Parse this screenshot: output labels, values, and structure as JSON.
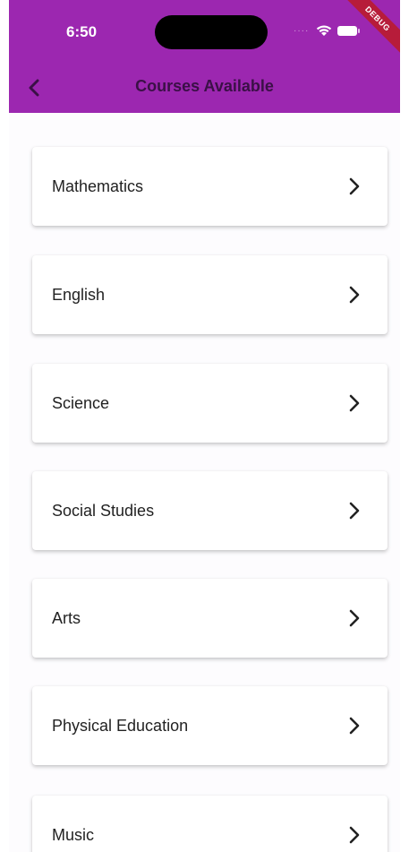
{
  "status_bar": {
    "time": "6:50",
    "debug_label": "DEBUG"
  },
  "app_bar": {
    "title": "Courses Available",
    "back_icon": "chevron-left-icon"
  },
  "courses": [
    {
      "label": "Mathematics"
    },
    {
      "label": "English"
    },
    {
      "label": "Science"
    },
    {
      "label": "Social Studies"
    },
    {
      "label": "Arts"
    },
    {
      "label": "Physical Education"
    },
    {
      "label": "Music"
    }
  ],
  "colors": {
    "app_bar": "#9c27b0",
    "title": "#3a1046",
    "card": "#ffffff"
  }
}
